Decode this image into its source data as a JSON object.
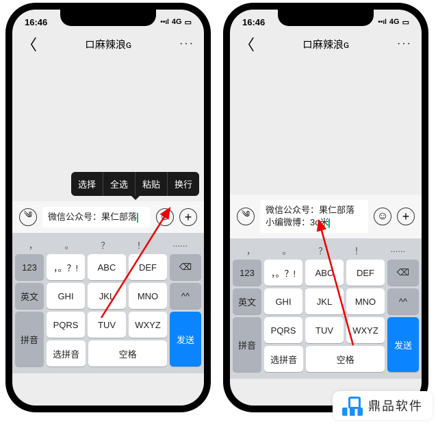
{
  "status": {
    "time": "16:46",
    "net": "4G"
  },
  "nav": {
    "title": "ロ麻辣浪ɢ",
    "back": "〈",
    "more": "···"
  },
  "popup": {
    "select": "选择",
    "selectAll": "全选",
    "paste": "粘贴",
    "newline": "换行"
  },
  "messages": {
    "p1": "微信公众号：果仁部落",
    "p2_l1": "微信公众号：果仁部落",
    "p2_l2": "小编微博：3o米"
  },
  "kbd": {
    "hint": {
      "h1": "，",
      "h2": "。",
      "h3": "？",
      "h4": "！",
      "h5": "......"
    },
    "left": {
      "k1": "123",
      "k2": "英文",
      "k3": "拼音"
    },
    "r1": {
      "a": "，。？!",
      "b": "ABC",
      "c": "DEF"
    },
    "r2": {
      "a": "GHI",
      "b": "JKL",
      "c": "MNO"
    },
    "r3": {
      "a": "PQRS",
      "b": "TUV",
      "c": "WXYZ"
    },
    "r4": {
      "a": "选拼音",
      "b": "空格"
    },
    "right": {
      "del": "⌫",
      "sym": "^^",
      "send": "发送"
    }
  },
  "watermark": "鼎品软件"
}
